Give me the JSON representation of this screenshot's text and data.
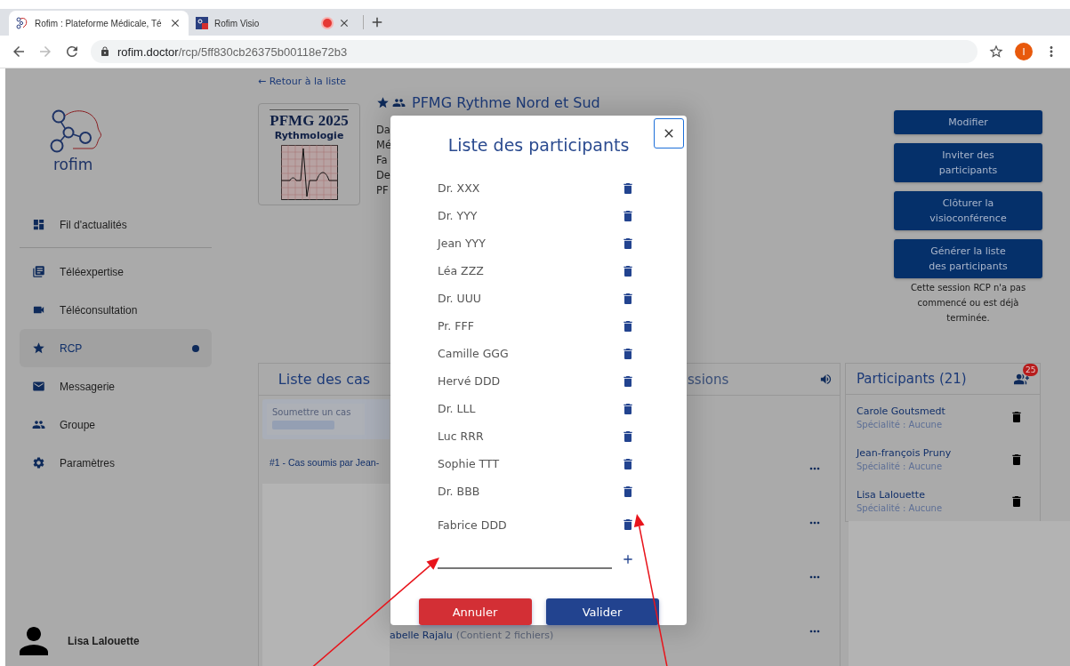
{
  "browser": {
    "tabs": [
      {
        "title": "Rofim : Plateforme Médicale, Té",
        "selected": true,
        "recording": false
      },
      {
        "title": "Rofim Visio",
        "selected": false,
        "recording": true
      }
    ],
    "url_host": "rofim.doctor",
    "url_path": "/rcp/5ff830cb26375b00118e72b3",
    "profile_initial": "I"
  },
  "sidebar": {
    "logo_text": "rofim",
    "items": [
      {
        "label": "Fil d'actualités",
        "selected": false,
        "dot": false
      },
      {
        "label": "Téléexpertise",
        "selected": false,
        "dot": false
      },
      {
        "label": "Téléconsultation",
        "selected": false,
        "dot": false
      },
      {
        "label": "RCP",
        "selected": true,
        "dot": true
      },
      {
        "label": "Messagerie",
        "selected": false,
        "dot": false
      },
      {
        "label": "Groupe",
        "selected": false,
        "dot": false
      },
      {
        "label": "Paramètres",
        "selected": false,
        "dot": false
      }
    ],
    "user": "Lisa Lalouette"
  },
  "back_link": "← Retour à la liste",
  "session": {
    "cover_title": "PFMG 2025",
    "cover_subtitle": "Rythmologie",
    "title": "PFMG Rythme Nord et Sud",
    "favorite": true,
    "details": [
      "Da",
      "Mé",
      "Fa",
      "De",
      "PF"
    ]
  },
  "actions": [
    "Modifier",
    "Inviter des participants",
    "Clôturer la visioconférence",
    "Générer la liste des participants"
  ],
  "session_note": "Cette session RCP n'a pas commencé ou est déjà terminée.",
  "cases_panel": {
    "tabs": [
      {
        "label": "Liste des cas",
        "selected": true
      },
      {
        "label": "ssions",
        "selected": false
      }
    ],
    "submit_label": "Soumettre un cas",
    "case_title": "#1 - Cas soumis par Jean-",
    "case_owner": "abelle Rajalu",
    "case_files": "(Contient 2 fichiers)"
  },
  "participants_panel": {
    "title": "Participants (21)",
    "badge": "25",
    "items": [
      {
        "name": "Carole Goutsmedt",
        "specialty": "Spécialité : Aucune"
      },
      {
        "name": "Jean-françois Pruny",
        "specialty": "Spécialité : Aucune"
      },
      {
        "name": "Lisa Lalouette",
        "specialty": "Spécialité : Aucune"
      }
    ]
  },
  "modal": {
    "title": "Liste des participants",
    "participants": [
      "Dr. XXX",
      "Dr. YYY",
      "Jean YYY",
      "Léa ZZZ",
      "Dr. UUU",
      "Pr. FFF",
      "Camille GGG",
      "Hervé DDD",
      "Dr. LLL",
      "Luc RRR",
      "Sophie TTT",
      "Dr. BBB",
      "Fabrice DDD"
    ],
    "buttons": [
      {
        "label": "Annuler",
        "kind": "cancel"
      },
      {
        "label": "Valider",
        "kind": "confirm"
      }
    ]
  }
}
